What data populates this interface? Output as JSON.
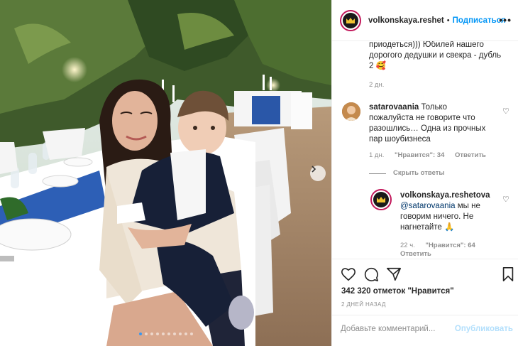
{
  "header": {
    "username": "volkonskaya.reshet",
    "separator": "•",
    "follow_label": "Подписаться",
    "more_label": "•••"
  },
  "caption": {
    "text": "приодеться))) Юбилей нашего дорогого дедушки и свекра - дубль 2 🥰",
    "time": "2 дн."
  },
  "comments": [
    {
      "username": "satarovaania",
      "text": "Только пожалуйста не говорите что разошлись… Одна из прочных пар шоубизнеса",
      "time": "1 дн.",
      "likes": "\"Нравится\": 34",
      "reply_label": "Ответить",
      "hide_replies": "Скрыть ответы"
    }
  ],
  "reply": {
    "username": "volkonskaya.reshetova",
    "mention": "@satarovaania",
    "text": " мы не говорим ничего. Не нагнетайте 🙏",
    "time": "22 ч.",
    "likes": "\"Нравится\": 64",
    "reply_label": "Ответить"
  },
  "footer": {
    "likes_text": "342 320 отметок \"Нравится\"",
    "date": "2 ДНЕЙ НАЗАД",
    "comment_placeholder": "Добавьте комментарий...",
    "publish_label": "Опубликовать"
  },
  "carousel": {
    "total_slides": 10,
    "active_index": 0
  },
  "colors": {
    "link_blue": "#0095f6",
    "disabled_blue": "#b2dffc",
    "muted_gray": "#8e8e8e",
    "text": "#262626",
    "mention": "#00376b",
    "active_dot": "#3897f0"
  },
  "icons": [
    "more-icon",
    "heart-icon",
    "comment-icon",
    "share-icon",
    "bookmark-icon",
    "chevron-right-icon"
  ]
}
